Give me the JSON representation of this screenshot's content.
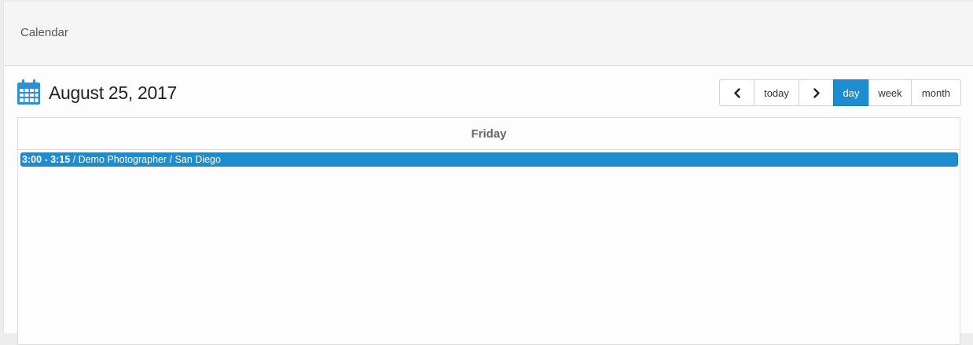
{
  "panel": {
    "title": "Calendar"
  },
  "toolbar": {
    "date_title": "August 25, 2017",
    "calendar_icon": "calendar-icon",
    "prev_icon": "chevron-left-icon",
    "next_icon": "chevron-right-icon",
    "today_label": "today",
    "views": [
      {
        "label": "day",
        "active": true
      },
      {
        "label": "week",
        "active": false
      },
      {
        "label": "month",
        "active": false
      }
    ]
  },
  "day_view": {
    "day_name": "Friday",
    "events": [
      {
        "time": "3:00 - 3:15",
        "title": " / Demo Photographer / San Diego"
      }
    ]
  },
  "colors": {
    "accent": "#1f8ccf",
    "header_bg": "#f5f5f5",
    "page_bg": "#ededed"
  }
}
